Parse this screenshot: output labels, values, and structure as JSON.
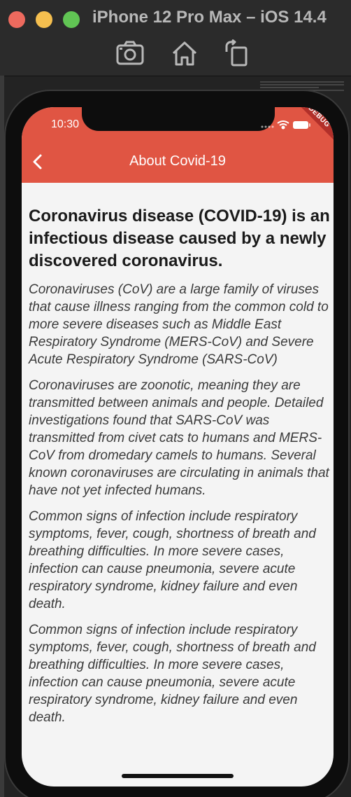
{
  "simulator": {
    "title": "iPhone 12 Pro Max – iOS 14.4",
    "toolbar": {
      "screenshot_icon": "camera-icon",
      "home_icon": "home-icon",
      "rotate_icon": "rotate-icon"
    }
  },
  "status_bar": {
    "time": "10:30",
    "debug_label": "DEBUG"
  },
  "app_bar": {
    "title": "About Covid-19",
    "back_icon": "chevron-left-icon",
    "color": "#e05543"
  },
  "article": {
    "headline": "Coronavirus disease (COVID-19) is an infectious disease caused by a newly discovered coronavirus.",
    "paragraphs": [
      "Coronaviruses (CoV) are a large family of viruses that cause illness ranging from the common cold to more severe diseases such as Middle East Respiratory Syndrome (MERS-CoV) and Severe Acute Respiratory Syndrome (SARS-CoV)",
      "Coronaviruses are zoonotic, meaning they are transmitted between animals and people. Detailed investigations found that SARS-CoV was transmitted from civet cats to humans and MERS-CoV from dromedary camels to humans. Several known coronaviruses are circulating in animals that have not yet infected humans.",
      "Common signs of infection include respiratory symptoms, fever, cough, shortness of breath and breathing difficulties. In more severe cases, infection can cause pneumonia, severe acute respiratory syndrome, kidney failure and even death.",
      "Common signs of infection include respiratory symptoms, fever, cough, shortness of breath and breathing difficulties. In more severe cases, infection can cause pneumonia, severe acute respiratory syndrome, kidney failure and even death."
    ]
  }
}
